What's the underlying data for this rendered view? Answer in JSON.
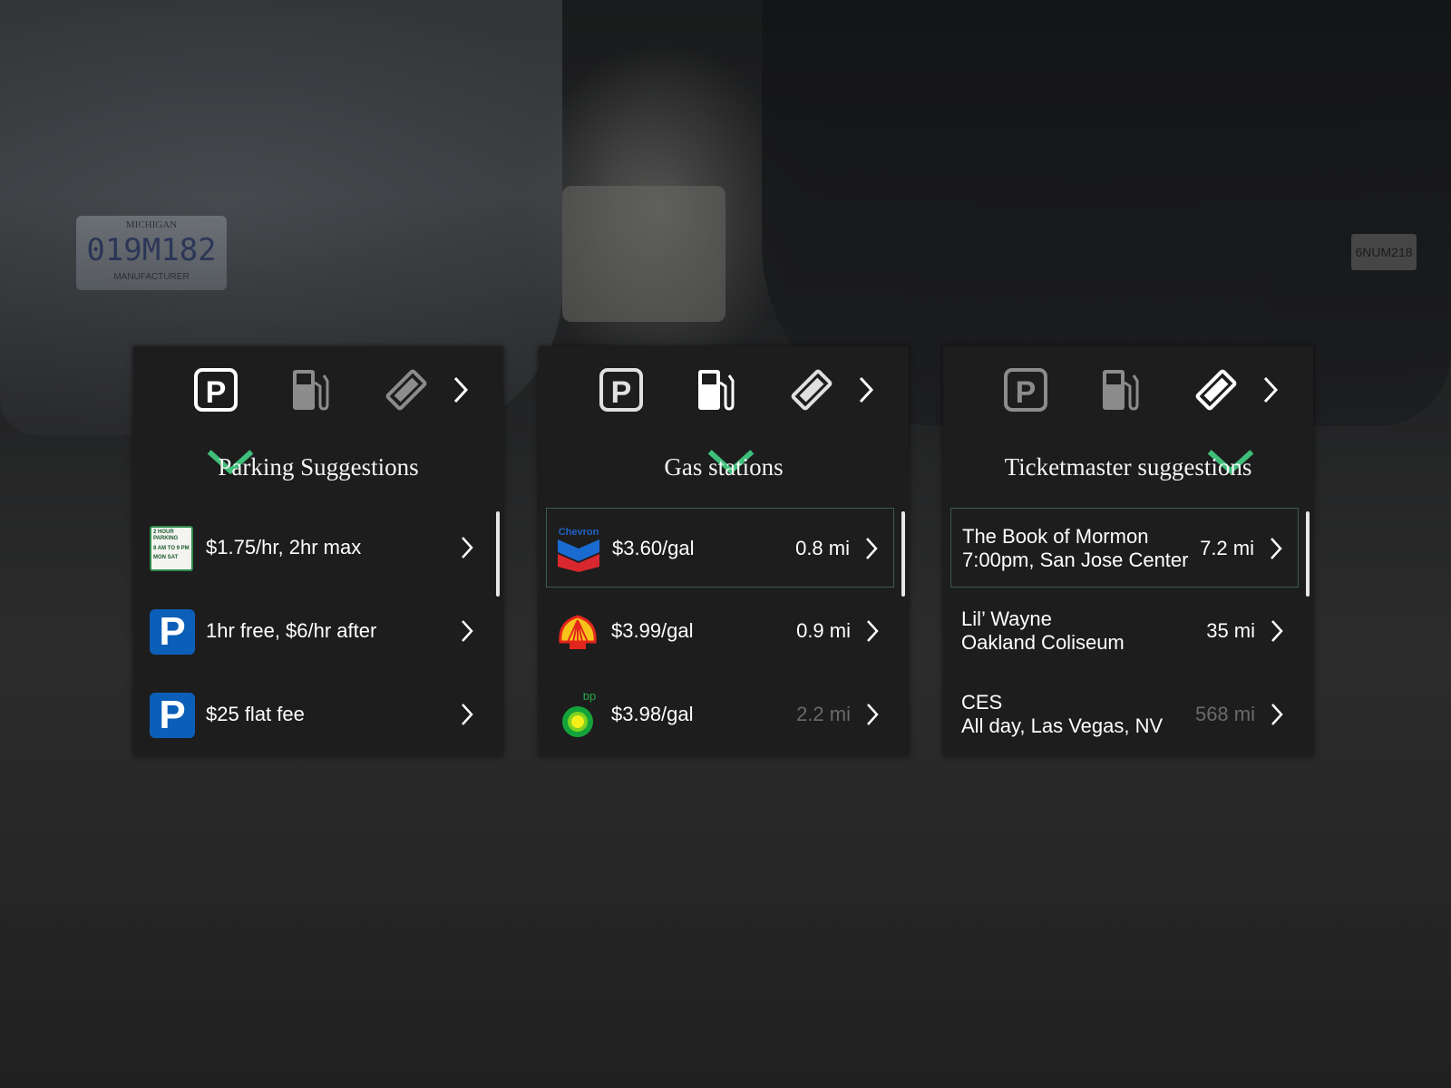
{
  "colors": {
    "accent": "#3fbf7a",
    "panel": "#1d1d1e",
    "active_icon": "#ffffff",
    "inactive_icon": "#8c8c8c",
    "parking_sign": "#0c5fb8"
  },
  "tab_icons": [
    "parking-icon",
    "fuel-pump-icon",
    "ticket-icon"
  ],
  "background": {
    "plate_state": "MICHIGAN",
    "plate_number": "019M182",
    "plate_bottom": "MANUFACTURER",
    "plate_right": "6NUM218"
  },
  "panels": [
    {
      "id": "parking",
      "title": "Parking Suggestions",
      "active_tab": 0,
      "items": [
        {
          "icon": "hour-parking-sign-icon",
          "text": "$1.75/hr, 2hr max",
          "sign_top": "2 HOUR PARKING",
          "sign_mid": "8 AM TO 9 PM",
          "sign_days": "MON  SAT"
        },
        {
          "icon": "parking-sign-icon",
          "text": "1hr free, $6/hr after",
          "sign_letter": "P"
        },
        {
          "icon": "parking-sign-icon",
          "text": "$25 flat fee",
          "sign_letter": "P"
        }
      ]
    },
    {
      "id": "gas",
      "title": "Gas stations",
      "active_tab": 1,
      "items": [
        {
          "icon": "chevron-logo-icon",
          "logo_text": "Chevron",
          "text": "$3.60/gal",
          "distance": "0.8 mi",
          "selected": true
        },
        {
          "icon": "shell-logo-icon",
          "text": "$3.99/gal",
          "distance": "0.9 mi"
        },
        {
          "icon": "bp-logo-icon",
          "logo_text": "bp",
          "text": "$3.98/gal",
          "distance": "2.2 mi",
          "dim": true
        }
      ]
    },
    {
      "id": "tickets",
      "title": "Ticketmaster suggestions",
      "active_tab": 2,
      "items": [
        {
          "line1": "The Book of Mormon",
          "line2": "7:00pm, San Jose Center",
          "distance": "7.2 mi",
          "selected": true
        },
        {
          "line1": "Lil’ Wayne",
          "line2": "Oakland Coliseum",
          "distance": "35 mi"
        },
        {
          "line1": "CES",
          "line2": "All day, Las Vegas, NV",
          "distance": "568 mi",
          "dim": true
        }
      ]
    }
  ]
}
